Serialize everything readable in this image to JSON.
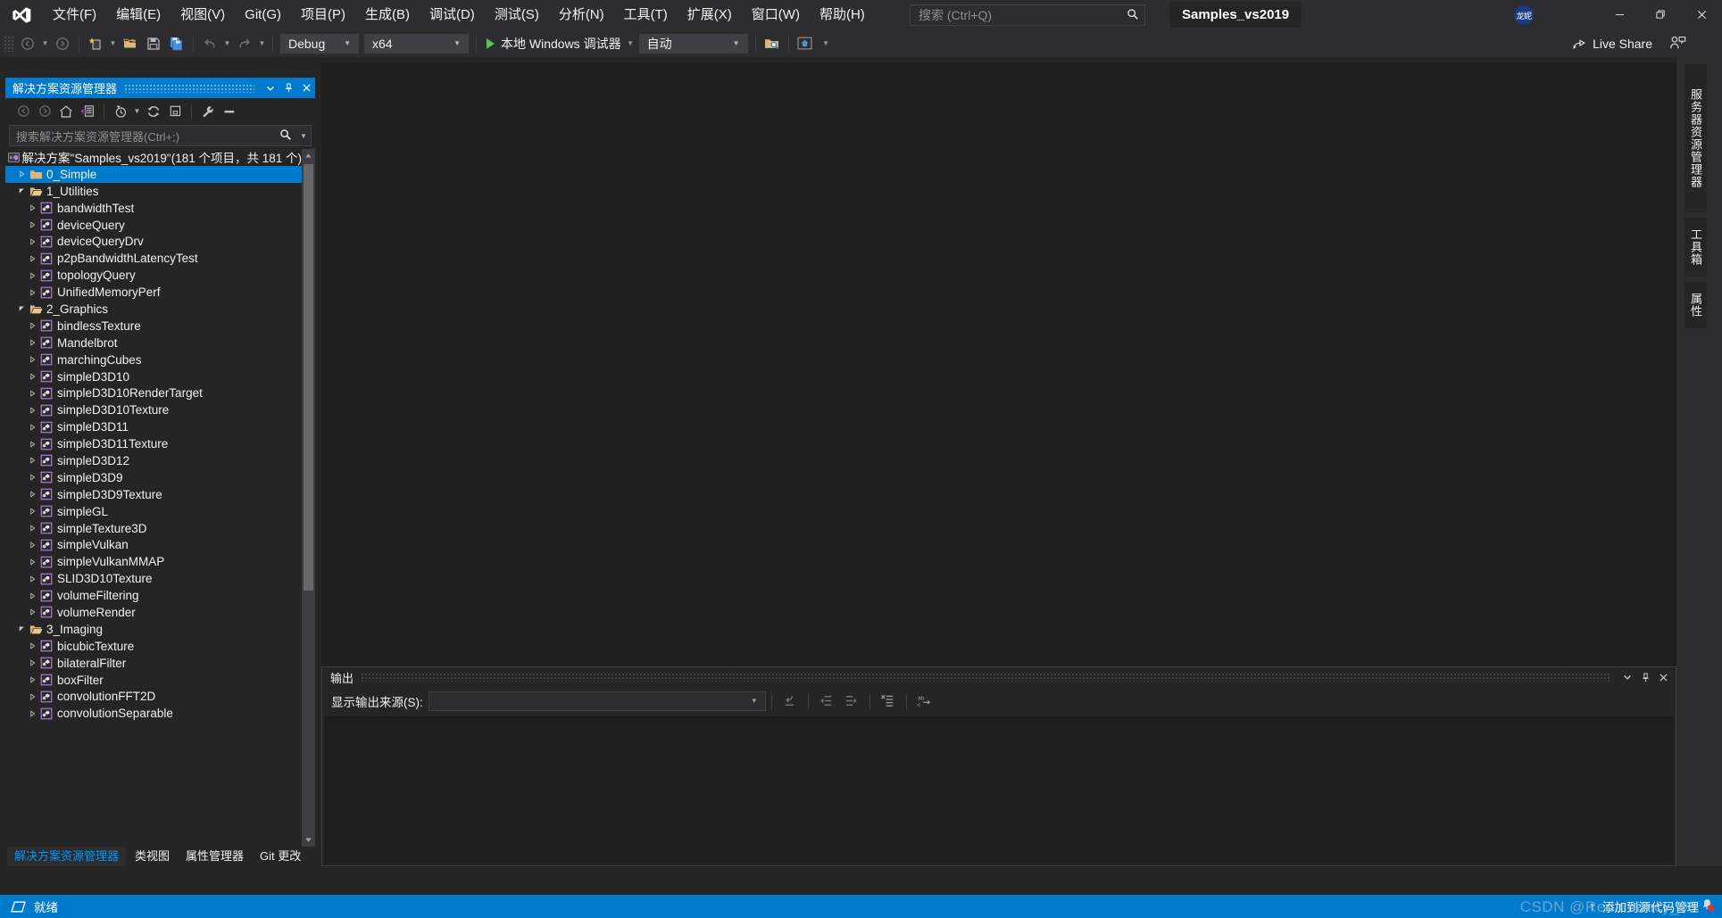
{
  "app": {
    "logo_icon": "visual-studio-logo",
    "solution_tab_label": "Samples_vs2019",
    "avatar_initials": "龙妮",
    "watermark": "CSDN @Redamancy_06"
  },
  "menubar": {
    "items": [
      {
        "label": "文件(F)",
        "name": "menu-file"
      },
      {
        "label": "编辑(E)",
        "name": "menu-edit"
      },
      {
        "label": "视图(V)",
        "name": "menu-view"
      },
      {
        "label": "Git(G)",
        "name": "menu-git"
      },
      {
        "label": "项目(P)",
        "name": "menu-project"
      },
      {
        "label": "生成(B)",
        "name": "menu-build"
      },
      {
        "label": "调试(D)",
        "name": "menu-debug"
      },
      {
        "label": "测试(S)",
        "name": "menu-test"
      },
      {
        "label": "分析(N)",
        "name": "menu-analyze"
      },
      {
        "label": "工具(T)",
        "name": "menu-tools"
      },
      {
        "label": "扩展(X)",
        "name": "menu-extensions"
      },
      {
        "label": "窗口(W)",
        "name": "menu-window"
      },
      {
        "label": "帮助(H)",
        "name": "menu-help"
      }
    ]
  },
  "search": {
    "placeholder": "搜索 (Ctrl+Q)",
    "icon": "search-icon"
  },
  "toolbar": {
    "configuration": "Debug",
    "platform": "x64",
    "run_label": "本地 Windows 调试器",
    "attach": "自动",
    "live_share_label": "Live Share",
    "icons": [
      "navigate-back-icon",
      "navigate-forward-icon",
      "new-item-icon",
      "open-file-icon",
      "save-icon",
      "save-all-icon",
      "undo-icon",
      "redo-icon",
      "find-in-files-icon",
      "preview-icon"
    ]
  },
  "window_controls": {
    "minimize": "minimize-icon",
    "maximize": "restore-icon",
    "close": "close-icon"
  },
  "solution_explorer": {
    "title": "解决方案资源管理器",
    "header_buttons": [
      "chevron-down-icon",
      "pin-icon",
      "close-icon"
    ],
    "toolbar_icons": [
      "back-icon",
      "forward-icon",
      "home-icon",
      "pending-changes-icon",
      "recent-icon",
      "refresh-icon",
      "collapse-all-icon",
      "properties-icon",
      "show-all-files-icon"
    ],
    "search_placeholder": "搜索解决方案资源管理器(Ctrl+;)",
    "search_icon": "search-icon",
    "solution_label": "解决方案\"Samples_vs2019\"(181 个项目，共 181 个)",
    "tree": [
      {
        "label": "0_Simple",
        "type": "folder",
        "depth": 1,
        "state": "collapsed",
        "selected": true
      },
      {
        "label": "1_Utilities",
        "type": "folder",
        "depth": 1,
        "state": "expanded",
        "selected": false
      },
      {
        "label": "bandwidthTest",
        "type": "project",
        "depth": 2,
        "state": "collapsed",
        "selected": false
      },
      {
        "label": "deviceQuery",
        "type": "project",
        "depth": 2,
        "state": "collapsed",
        "selected": false
      },
      {
        "label": "deviceQueryDrv",
        "type": "project",
        "depth": 2,
        "state": "collapsed",
        "selected": false
      },
      {
        "label": "p2pBandwidthLatencyTest",
        "type": "project",
        "depth": 2,
        "state": "collapsed",
        "selected": false
      },
      {
        "label": "topologyQuery",
        "type": "project",
        "depth": 2,
        "state": "collapsed",
        "selected": false
      },
      {
        "label": "UnifiedMemoryPerf",
        "type": "project",
        "depth": 2,
        "state": "collapsed",
        "selected": false
      },
      {
        "label": "2_Graphics",
        "type": "folder",
        "depth": 1,
        "state": "expanded",
        "selected": false
      },
      {
        "label": "bindlessTexture",
        "type": "project",
        "depth": 2,
        "state": "collapsed",
        "selected": false
      },
      {
        "label": "Mandelbrot",
        "type": "project",
        "depth": 2,
        "state": "collapsed",
        "selected": false
      },
      {
        "label": "marchingCubes",
        "type": "project",
        "depth": 2,
        "state": "collapsed",
        "selected": false
      },
      {
        "label": "simpleD3D10",
        "type": "project",
        "depth": 2,
        "state": "collapsed",
        "selected": false
      },
      {
        "label": "simpleD3D10RenderTarget",
        "type": "project",
        "depth": 2,
        "state": "collapsed",
        "selected": false
      },
      {
        "label": "simpleD3D10Texture",
        "type": "project",
        "depth": 2,
        "state": "collapsed",
        "selected": false
      },
      {
        "label": "simpleD3D11",
        "type": "project",
        "depth": 2,
        "state": "collapsed",
        "selected": false
      },
      {
        "label": "simpleD3D11Texture",
        "type": "project",
        "depth": 2,
        "state": "collapsed",
        "selected": false
      },
      {
        "label": "simpleD3D12",
        "type": "project",
        "depth": 2,
        "state": "collapsed",
        "selected": false
      },
      {
        "label": "simpleD3D9",
        "type": "project",
        "depth": 2,
        "state": "collapsed",
        "selected": false
      },
      {
        "label": "simpleD3D9Texture",
        "type": "project",
        "depth": 2,
        "state": "collapsed",
        "selected": false
      },
      {
        "label": "simpleGL",
        "type": "project",
        "depth": 2,
        "state": "collapsed",
        "selected": false
      },
      {
        "label": "simpleTexture3D",
        "type": "project",
        "depth": 2,
        "state": "collapsed",
        "selected": false
      },
      {
        "label": "simpleVulkan",
        "type": "project",
        "depth": 2,
        "state": "collapsed",
        "selected": false
      },
      {
        "label": "simpleVulkanMMAP",
        "type": "project",
        "depth": 2,
        "state": "collapsed",
        "selected": false
      },
      {
        "label": "SLID3D10Texture",
        "type": "project",
        "depth": 2,
        "state": "collapsed",
        "selected": false
      },
      {
        "label": "volumeFiltering",
        "type": "project",
        "depth": 2,
        "state": "collapsed",
        "selected": false
      },
      {
        "label": "volumeRender",
        "type": "project",
        "depth": 2,
        "state": "collapsed",
        "selected": false
      },
      {
        "label": "3_Imaging",
        "type": "folder",
        "depth": 1,
        "state": "expanded",
        "selected": false
      },
      {
        "label": "bicubicTexture",
        "type": "project",
        "depth": 2,
        "state": "collapsed",
        "selected": false
      },
      {
        "label": "bilateralFilter",
        "type": "project",
        "depth": 2,
        "state": "collapsed",
        "selected": false
      },
      {
        "label": "boxFilter",
        "type": "project",
        "depth": 2,
        "state": "collapsed",
        "selected": false
      },
      {
        "label": "convolutionFFT2D",
        "type": "project",
        "depth": 2,
        "state": "collapsed",
        "selected": false
      },
      {
        "label": "convolutionSeparable",
        "type": "project",
        "depth": 2,
        "state": "collapsed",
        "selected": false
      }
    ],
    "tabs": [
      {
        "label": "解决方案资源管理器",
        "active": true
      },
      {
        "label": "类视图",
        "active": false
      },
      {
        "label": "属性管理器",
        "active": false
      },
      {
        "label": "Git 更改",
        "active": false
      }
    ]
  },
  "output_panel": {
    "title": "输出",
    "header_buttons": [
      "chevron-down-icon",
      "pin-icon",
      "close-icon"
    ],
    "source_label": "显示输出来源(S):",
    "source_value": "",
    "toolbar_icons": [
      "jump-to-source-icon",
      "prev-message-icon",
      "next-message-icon",
      "clear-all-icon",
      "toggle-word-wrap-icon"
    ],
    "body_text": ""
  },
  "right_tabs": [
    {
      "label": "服务器资源管理器",
      "name": "vtab-server-explorer"
    },
    {
      "label": "工具箱",
      "name": "vtab-toolbox"
    },
    {
      "label": "属性",
      "name": "vtab-properties"
    }
  ],
  "status_bar": {
    "ready_text": "就绪",
    "ready_icon": "ready-icon",
    "source_control_text": "添加到源代码管理",
    "source_control_icon": "arrow-up-icon",
    "notification_icon": "bell-icon"
  },
  "colors": {
    "accent": "#007acc",
    "chrome": "#2d2d30",
    "panel": "#252526",
    "editor": "#1e1e1e",
    "folder": "#dcb67a",
    "project": "#b180d7",
    "text": "#f1f1f1"
  }
}
